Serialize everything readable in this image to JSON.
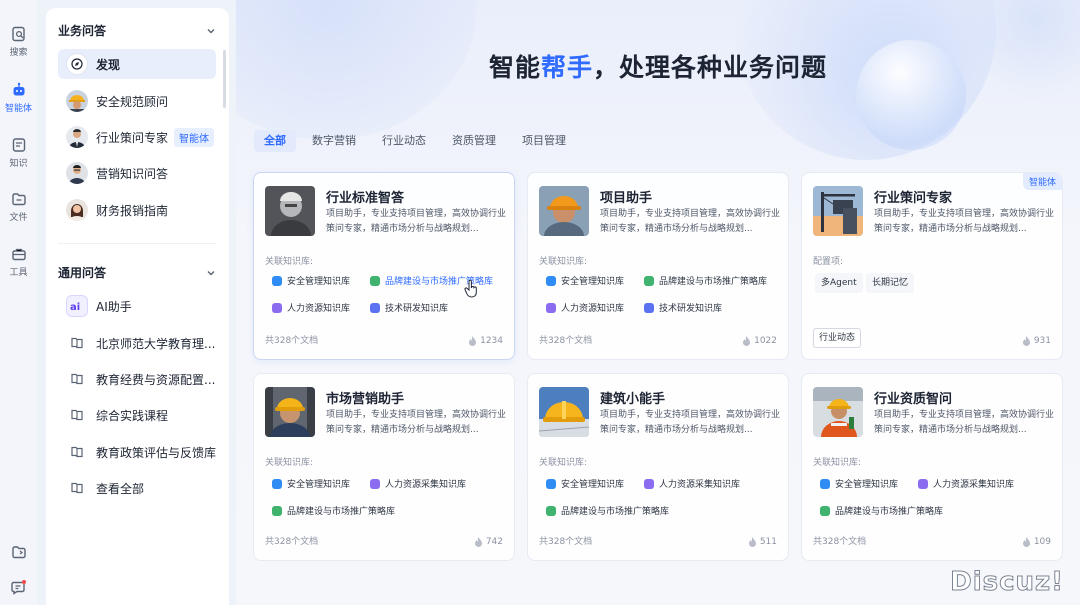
{
  "rail": {
    "items": [
      {
        "label": "搜索",
        "icon": "search-icon"
      },
      {
        "label": "智能体",
        "icon": "robot-icon",
        "active": true
      },
      {
        "label": "知识",
        "icon": "knowledge-icon"
      },
      {
        "label": "文件",
        "icon": "folder-icon"
      },
      {
        "label": "工具",
        "icon": "toolbox-icon"
      }
    ],
    "bottom": [
      "folder-share-icon",
      "feedback-icon"
    ]
  },
  "sidebar": {
    "business": {
      "title": "业务问答",
      "items": [
        {
          "label": "发现",
          "active": true,
          "icon": "compass-icon"
        },
        {
          "label": "安全规范顾问",
          "icon": "avatar-worker-helmet"
        },
        {
          "label": "行业策问专家",
          "tag": "智能体",
          "icon": "avatar-man-suit"
        },
        {
          "label": "营销知识问答",
          "icon": "avatar-man-glasses"
        },
        {
          "label": "财务报销指南",
          "icon": "avatar-woman"
        }
      ]
    },
    "general": {
      "title": "通用问答",
      "items": [
        {
          "label": "AI助手",
          "icon": "ai-logo-icon"
        },
        {
          "label": "北京师范大学教育理...",
          "icon": "book-icon"
        },
        {
          "label": "教育经费与资源配置...",
          "icon": "book-icon"
        },
        {
          "label": "综合实践课程",
          "icon": "book-icon"
        },
        {
          "label": "教育政策评估与反馈库",
          "icon": "book-icon"
        },
        {
          "label": "查看全部",
          "icon": "book-icon"
        }
      ]
    }
  },
  "hero": {
    "title_a": "智能",
    "title_b": "帮手",
    "title_c": "，处理各种业务问题"
  },
  "tabs": [
    "全部",
    "数字营销",
    "行业动态",
    "资质管理",
    "项目管理"
  ],
  "colors": {
    "accent": "#2f6bff",
    "chip_blue": "#2f8cf5",
    "chip_green": "#3fb36e",
    "chip_purple": "#8b6cf0",
    "chip_indigo": "#5a72f2"
  },
  "cards": [
    {
      "title": "行业标准智答",
      "desc": "项目助手，专业支持项目管理，高效协调行业策问专家，精通市场分析与战略规划...",
      "label": "关联知识库:",
      "chips": [
        {
          "text": "安全管理知识库",
          "color": "#2f8cf5"
        },
        {
          "text": "品牌建设与市场推广策略库",
          "color": "#3fb36e"
        },
        {
          "text": "人力资源知识库",
          "color": "#8b6cf0"
        },
        {
          "text": "技术研发知识库",
          "color": "#5a72f2"
        }
      ],
      "foot": "共328个文档",
      "count": "1234"
    },
    {
      "title": "项目助手",
      "desc": "项目助手，专业支持项目管理，高效协调行业策问专家，精通市场分析与战略规划...",
      "label": "关联知识库:",
      "chips": [
        {
          "text": "安全管理知识库",
          "color": "#2f8cf5"
        },
        {
          "text": "品牌建设与市场推广策略库",
          "color": "#3fb36e"
        },
        {
          "text": "人力资源知识库",
          "color": "#8b6cf0"
        },
        {
          "text": "技术研发知识库",
          "color": "#5a72f2"
        }
      ],
      "foot": "共328个文档",
      "count": "1022"
    },
    {
      "title": "行业策问专家",
      "desc": "项目助手，专业支持项目管理，高效协调行业策问专家，精通市场分析与战略规划...",
      "corner": "智能体",
      "label": "配置项:",
      "plain": [
        "多Agent",
        "长期记忆"
      ],
      "outline": "行业动态",
      "count": "931"
    },
    {
      "title": "市场营销助手",
      "desc": "项目助手，专业支持项目管理，高效协调行业策问专家，精通市场分析与战略规划...",
      "label": "关联知识库:",
      "chips": [
        {
          "text": "安全管理知识库",
          "color": "#2f8cf5"
        },
        {
          "text": "人力资源采集知识库",
          "color": "#8b6cf0"
        },
        {
          "text": "品牌建设与市场推广策略库",
          "color": "#3fb36e"
        }
      ],
      "foot": "共328个文档",
      "count": "742"
    },
    {
      "title": "建筑小能手",
      "desc": "项目助手，专业支持项目管理，高效协调行业策问专家，精通市场分析与战略规划...",
      "label": "关联知识库:",
      "chips": [
        {
          "text": "安全管理知识库",
          "color": "#2f8cf5"
        },
        {
          "text": "人力资源采集知识库",
          "color": "#8b6cf0"
        },
        {
          "text": "品牌建设与市场推广策略库",
          "color": "#3fb36e"
        }
      ],
      "foot": "共328个文档",
      "count": "511"
    },
    {
      "title": "行业资质智问",
      "desc": "项目助手，专业支持项目管理，高效协调行业策问专家，精通市场分析与战略规划...",
      "label": "关联知识库:",
      "chips": [
        {
          "text": "安全管理知识库",
          "color": "#2f8cf5"
        },
        {
          "text": "人力资源采集知识库",
          "color": "#8b6cf0"
        },
        {
          "text": "品牌建设与市场推广策略库",
          "color": "#3fb36e"
        }
      ],
      "foot": "共328个文档",
      "count": "109"
    }
  ],
  "watermark": "Discuz!"
}
